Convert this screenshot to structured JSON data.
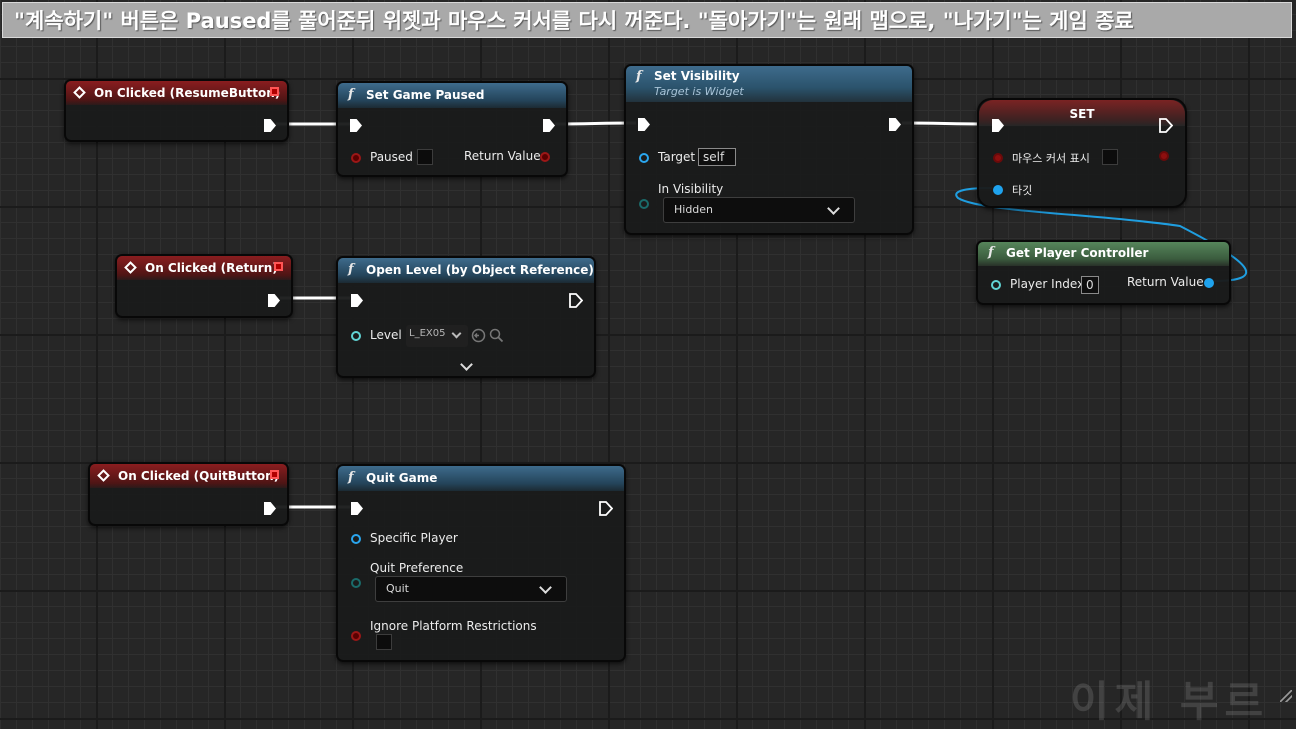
{
  "banner": {
    "text": "\"계속하기\" 버튼은 Paused를 풀어준뒤 위젯과 마우스 커서를 다시 꺼준다. \"돌아가기\"는 원래 맵으로, \"나가기\"는 게임 종료"
  },
  "nodes": {
    "on_clicked_resume": {
      "title": "On Clicked (ResumeButton)"
    },
    "on_clicked_return": {
      "title": "On Clicked (Return)"
    },
    "on_clicked_quit": {
      "title": "On Clicked (QuitButton)"
    },
    "set_game_paused": {
      "title": "Set Game Paused",
      "paused_label": "Paused",
      "return_label": "Return Value"
    },
    "set_visibility": {
      "title": "Set Visibility",
      "subtitle": "Target is Widget",
      "target_label": "Target",
      "target_value": "self",
      "visibility_label": "In Visibility",
      "visibility_value": "Hidden"
    },
    "set_var": {
      "title": "SET",
      "var_label": "마우스 커서 표시",
      "target_label": "타깃"
    },
    "get_player_controller": {
      "title": "Get Player Controller",
      "index_label": "Player Index",
      "index_value": "0",
      "return_label": "Return Value"
    },
    "open_level": {
      "title": "Open Level (by Object Reference)",
      "level_label": "Level",
      "level_value": "L_EX05"
    },
    "quit_game": {
      "title": "Quit Game",
      "specific_player_label": "Specific Player",
      "quit_pref_label": "Quit Preference",
      "quit_pref_value": "Quit",
      "ignore_label": "Ignore Platform Restrictions"
    }
  },
  "watermark": {
    "text": "이제 부르"
  },
  "colors": {
    "event_header": "#8a1d1f",
    "function_header": "#3e6b8c",
    "pure_header": "#56855b",
    "object_pin": "#1fa3ee",
    "bool_pin": "#8d0f0f",
    "exec_wire": "#ffffff"
  }
}
